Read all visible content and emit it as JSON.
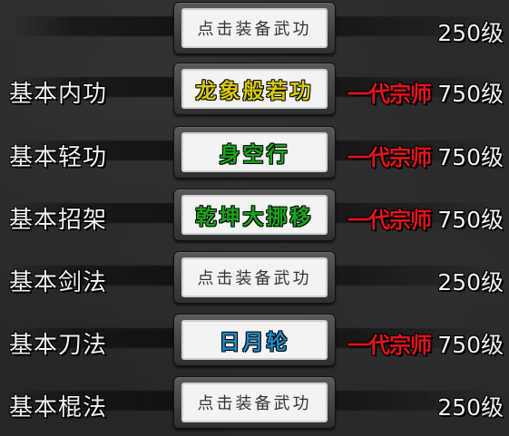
{
  "rows": [
    {
      "category": "",
      "skill": "点击装备武功",
      "skill_equipped": false,
      "skill_color": "#333333",
      "rank": "",
      "level": "250级"
    },
    {
      "category": "基本内功",
      "skill": "龙象般若功",
      "skill_equipped": true,
      "skill_color": "#d6c80a",
      "rank": "一代宗师",
      "level": "750级"
    },
    {
      "category": "基本轻功",
      "skill": "身空行",
      "skill_equipped": true,
      "skill_color": "#1aa51a",
      "rank": "一代宗师",
      "level": "750级"
    },
    {
      "category": "基本招架",
      "skill": "乾坤大挪移",
      "skill_equipped": true,
      "skill_color": "#1aa51a",
      "rank": "一代宗师",
      "level": "750级"
    },
    {
      "category": "基本剑法",
      "skill": "点击装备武功",
      "skill_equipped": false,
      "skill_color": "#333333",
      "rank": "",
      "level": "250级"
    },
    {
      "category": "基本刀法",
      "skill": "日月轮",
      "skill_equipped": true,
      "skill_color": "#1f88c7",
      "rank": "一代宗师",
      "level": "750级"
    },
    {
      "category": "基本棍法",
      "skill": "点击装备武功",
      "skill_equipped": false,
      "skill_color": "#333333",
      "rank": "",
      "level": "250级"
    }
  ]
}
